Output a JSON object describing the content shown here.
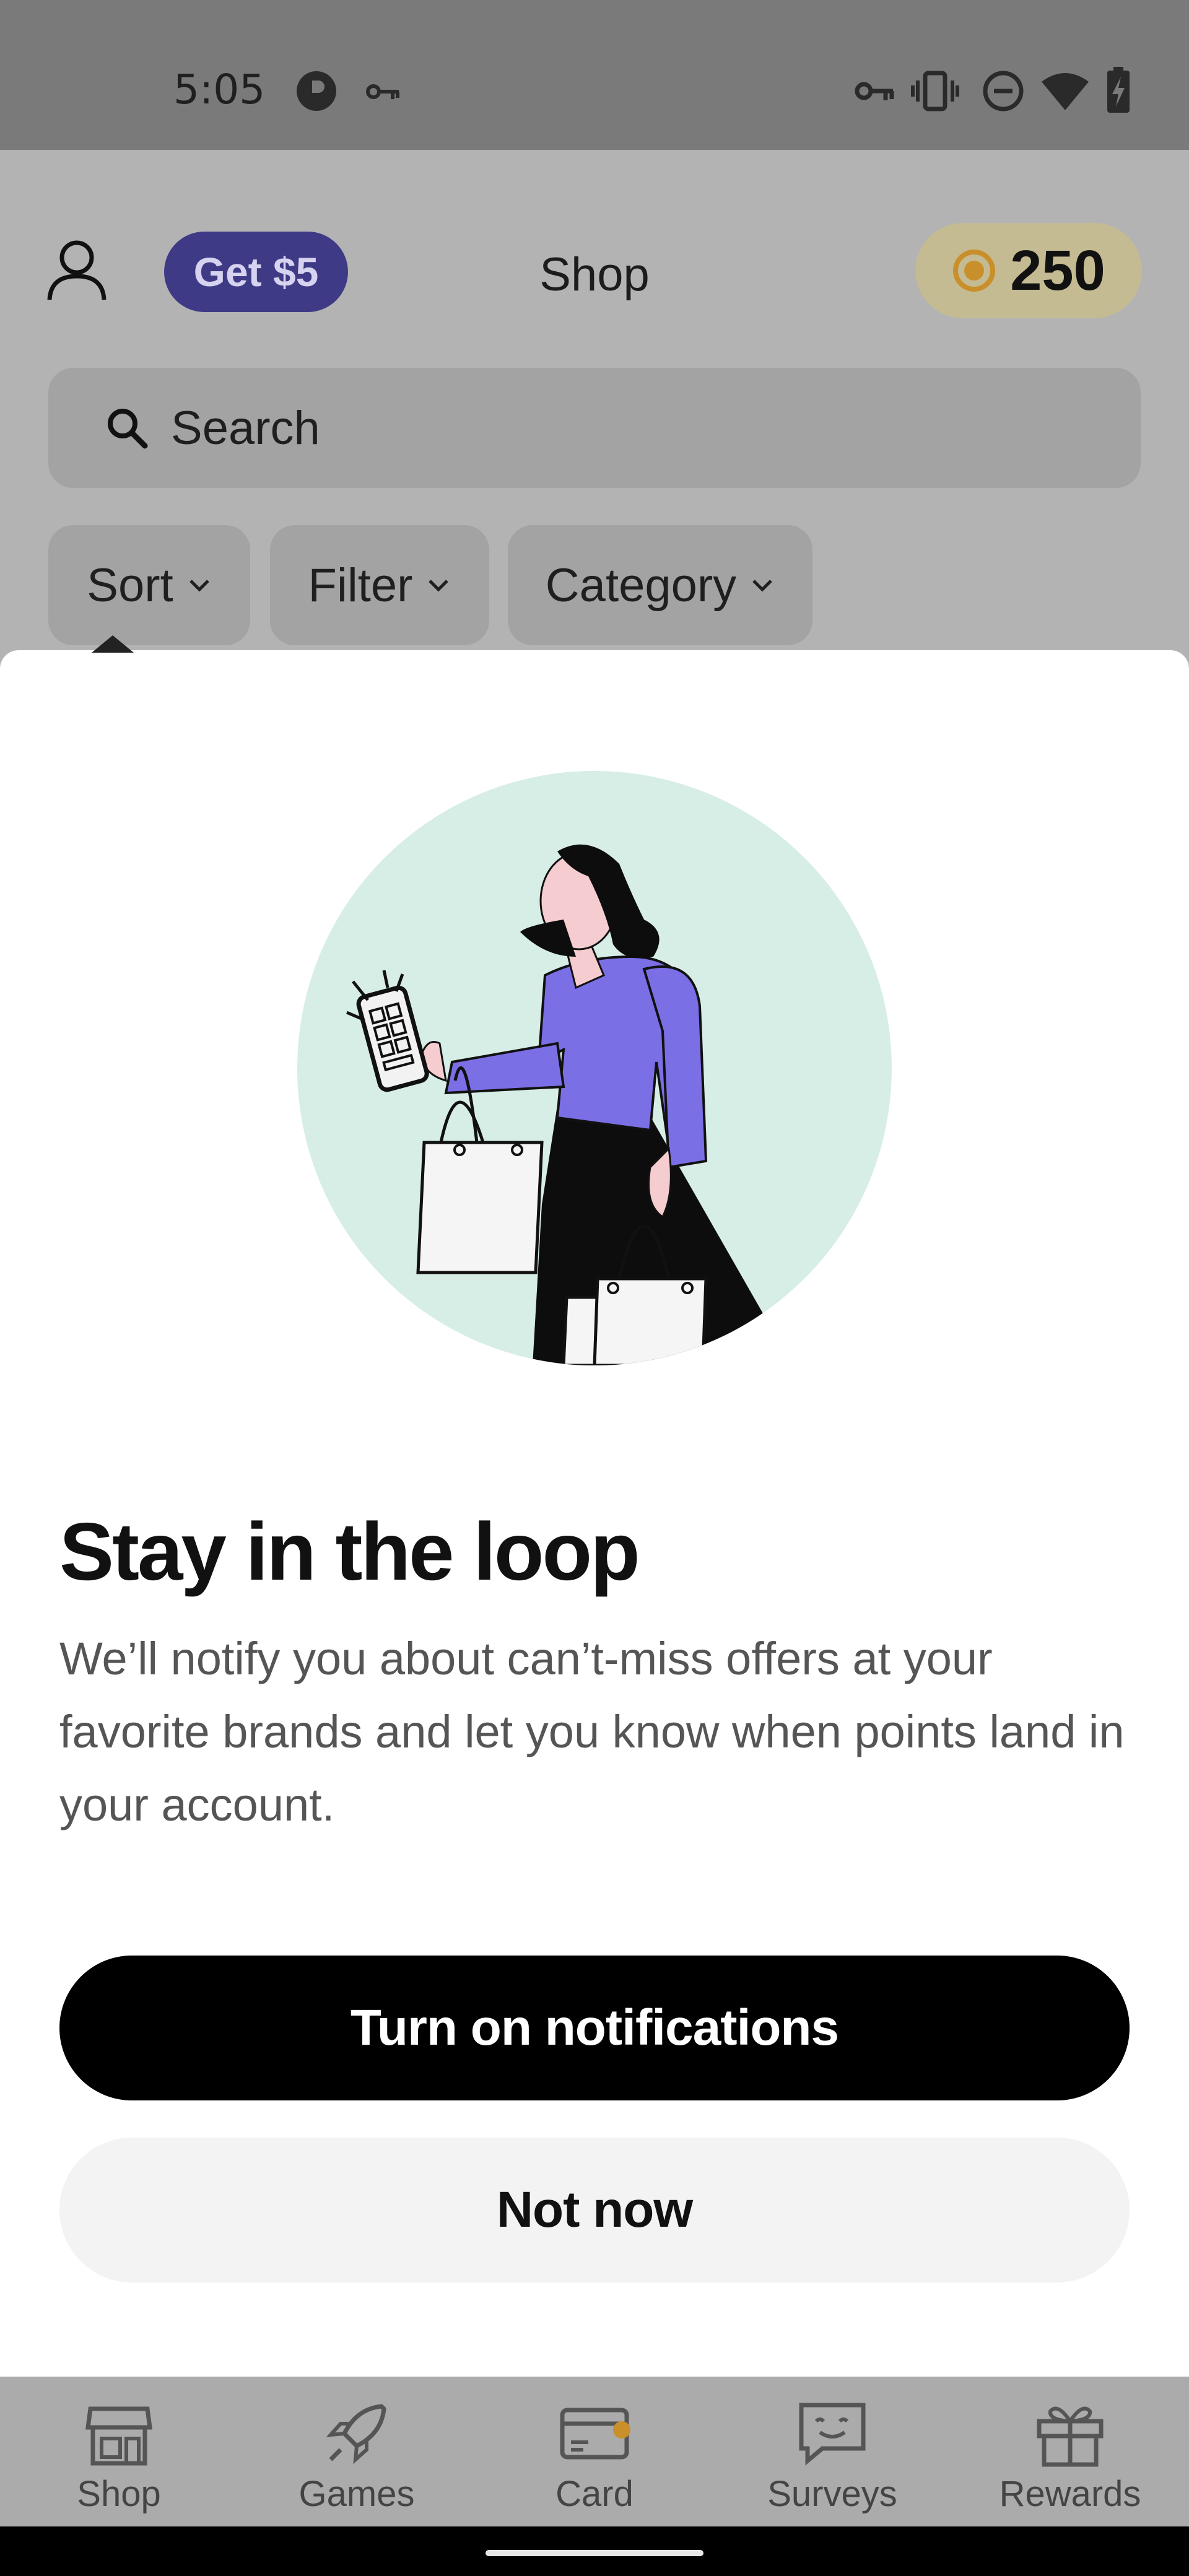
{
  "status_bar": {
    "time": "5:05",
    "icons": [
      "p-circle-icon",
      "key-icon",
      "key-icon",
      "vibrate-icon",
      "do-not-disturb-icon",
      "wifi-icon",
      "battery-charging-icon"
    ]
  },
  "header": {
    "profile_icon": "user-icon",
    "promo_label": "Get $5",
    "title": "Shop",
    "points_icon": "coin-icon",
    "points": "250"
  },
  "search": {
    "placeholder": "Search",
    "icon": "search-icon"
  },
  "filters": [
    {
      "label": "Sort"
    },
    {
      "label": "Filter"
    },
    {
      "label": "Category"
    }
  ],
  "sheet": {
    "illustration": "woman-shopping-illustration",
    "title": "Stay in the loop",
    "body": "We’ll notify you about can’t-miss offers at your favorite brands and let you know when points land in your account.",
    "primary_button": "Turn on notifications",
    "secondary_button": "Not now"
  },
  "bottom_nav": [
    {
      "label": "Shop",
      "icon": "store-icon"
    },
    {
      "label": "Games",
      "icon": "rocket-icon"
    },
    {
      "label": "Card",
      "icon": "card-icon"
    },
    {
      "label": "Surveys",
      "icon": "survey-chat-icon"
    },
    {
      "label": "Rewards",
      "icon": "gift-icon"
    }
  ],
  "colors": {
    "promo": "#3f3a86",
    "points_pill": "#c4bb93",
    "coin": "#c98f2a",
    "shirt": "#7b6fe6",
    "circle": "#d7eee6"
  }
}
